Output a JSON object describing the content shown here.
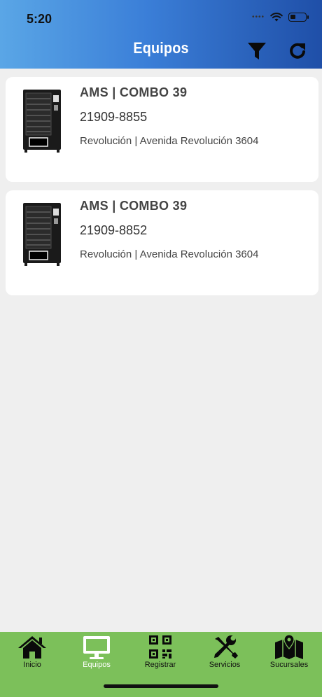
{
  "status": {
    "time": "5:20",
    "battery_level": 0.35
  },
  "header": {
    "title": "Equipos",
    "filter_icon": "filter-icon",
    "refresh_icon": "refresh-icon"
  },
  "equipos": [
    {
      "brand": "AMS  |  COMBO 39",
      "serial": "21909-8855",
      "location": "Revolución | Avenida Revolución 3604"
    },
    {
      "brand": "AMS  |  COMBO 39",
      "serial": "21909-8852",
      "location": "Revolución | Avenida Revolución 3604"
    }
  ],
  "tabs": [
    {
      "label": "Inicio",
      "icon": "home-icon",
      "active": false
    },
    {
      "label": "Equipos",
      "icon": "monitor-icon",
      "active": true
    },
    {
      "label": "Registrar",
      "icon": "qr-code-icon",
      "active": false
    },
    {
      "label": "Servicios",
      "icon": "tools-icon",
      "active": false
    },
    {
      "label": "Sucursales",
      "icon": "map-pin-icon",
      "active": false
    }
  ],
  "colors": {
    "header_start": "#5aa6e6",
    "header_end": "#1f4fa8",
    "tabbar": "#7cc05a",
    "background": "#efefef"
  }
}
